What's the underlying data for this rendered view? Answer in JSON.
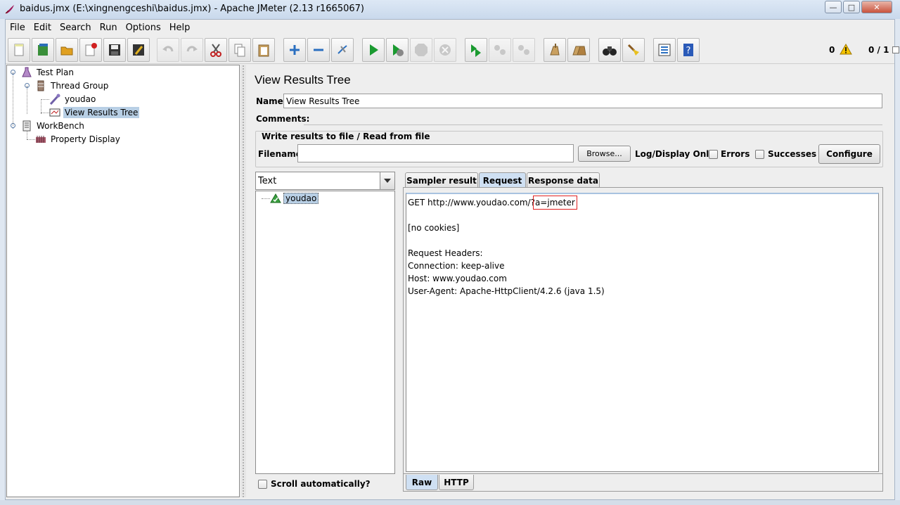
{
  "window": {
    "title": "baidus.jmx (E:\\xingnengceshi\\baidus.jmx) - Apache JMeter (2.13 r1665067)",
    "min_label": "—",
    "max_label": "□",
    "close_label": "✕"
  },
  "menu": {
    "file": "File",
    "edit": "Edit",
    "search": "Search",
    "run": "Run",
    "options": "Options",
    "help": "Help"
  },
  "toolbar": {
    "error_count": "0",
    "thread_count": "0 / 1",
    "buttons": [
      "new-icon",
      "templates-icon",
      "open-icon",
      "close-icon",
      "save-icon",
      "save-as-icon",
      "undo-icon",
      "redo-icon",
      "cut-icon",
      "copy-icon",
      "paste-icon",
      "expand-icon",
      "collapse-icon",
      "toggle-icon",
      "start-icon",
      "start-no-pauses-icon",
      "stop-icon",
      "shutdown-icon",
      "remote-start-icon",
      "remote-stop-icon",
      "remote-shutdown-icon",
      "clear-icon",
      "clear-all-icon",
      "search-icon",
      "reset-search-icon",
      "function-helper-icon",
      "help-icon"
    ]
  },
  "tree": {
    "items": [
      {
        "label": "Test Plan",
        "icon": "test-plan-icon"
      },
      {
        "label": "Thread Group",
        "icon": "thread-group-icon"
      },
      {
        "label": "youdao",
        "icon": "http-sampler-icon"
      },
      {
        "label": "View Results Tree",
        "icon": "listener-icon",
        "selected": true
      },
      {
        "label": "WorkBench",
        "icon": "workbench-icon"
      },
      {
        "label": "Property Display",
        "icon": "property-display-icon"
      }
    ]
  },
  "panel": {
    "title": "View Results Tree",
    "name_label": "Name:",
    "name_value": "View Results Tree",
    "comments_label": "Comments:",
    "file_group_title": "Write results to file / Read from file",
    "filename_label": "Filename",
    "filename_value": "",
    "browse_label": "Browse...",
    "log_display_label": "Log/Display Only:",
    "errors_label": "Errors",
    "successes_label": "Successes",
    "configure_label": "Configure"
  },
  "results": {
    "renderer": "Text",
    "items": [
      {
        "label": "youdao",
        "status": "success"
      }
    ],
    "scroll_auto_label": "Scroll automatically?"
  },
  "tabs": {
    "sampler_result": "Sampler result",
    "request": "Request",
    "response_data": "Response data",
    "active": "Request"
  },
  "request": {
    "url_prefix": "GET http://www.youdao.com/?",
    "url_query": "a=jmeter",
    "cookies": "[no cookies]",
    "headers_title": "Request Headers:",
    "headers": [
      "Connection: keep-alive",
      "Host: www.youdao.com",
      "User-Agent: Apache-HttpClient/4.2.6 (java 1.5)"
    ]
  },
  "bottom_tabs": {
    "raw": "Raw",
    "http": "HTTP",
    "active": "Raw"
  }
}
